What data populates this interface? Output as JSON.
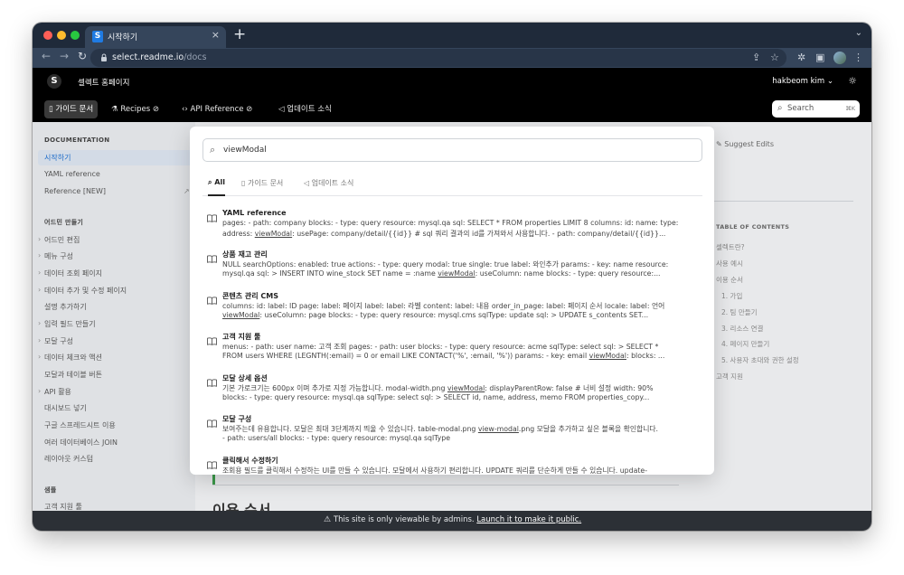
{
  "browser": {
    "tab_title": "시작하기",
    "tab_favicon": "S",
    "tab_close": "×",
    "new_tab": "+",
    "url_host": "select.readme.io",
    "url_path": "/docs"
  },
  "site": {
    "logo_letter": "S",
    "name": "셀렉트 홈페이지",
    "user": "hakbeom kim ⌄",
    "nav": [
      {
        "label": "가이드 문서"
      },
      {
        "label": "Recipes"
      },
      {
        "label": "API Reference"
      },
      {
        "label": "업데이트 소식"
      }
    ],
    "search_placeholder": "Search",
    "search_shortcut": "⌘K"
  },
  "sidebar": {
    "section1": "DOCUMENTATION",
    "items1": [
      "시작하기",
      "YAML reference",
      "Reference [NEW]"
    ],
    "section2": "어드민 만들기",
    "items2": [
      "어드민 편집",
      "메뉴 구성",
      "데이터 조회 페이지",
      "데이터 추가 및 수정 페이지",
      "설명 추가하기",
      "입력 필드 만들기",
      "모달 구성",
      "데이터 체크와 액션",
      "모달과 테이블 버튼",
      "API 활용",
      "대시보드 넣기",
      "구글 스프레드시트 이용",
      "여러 데이터베이스 JOIN",
      "레이아웃 커스텀"
    ],
    "section3": "샘플",
    "items3": [
      "고객 지원 툴"
    ]
  },
  "content": {
    "suggest_edits": "Suggest Edits",
    "heading_peek": "이용 순서",
    "toc_title": "TABLE OF CONTENTS",
    "toc": [
      "셀렉트란?",
      "사용 예시",
      "이용 순서",
      "1. 가입",
      "2. 팀 만들기",
      "3. 리소스 연결",
      "4. 페이지 만들기",
      "5. 사용자 초대와 권한 설정",
      "고객 지원"
    ]
  },
  "search_modal": {
    "query": "viewModal",
    "tabs": [
      "All",
      "가이드 문서",
      "업데이트 소식"
    ],
    "results": [
      {
        "title": "YAML reference",
        "line1": "pages: - path: company blocks: - type: query resource: mysql.qa sql: SELECT * FROM properties LIMIT 8 columns: id: name: type:",
        "l2_pre": "address: ",
        "l2_hit": "viewModal",
        "l2_post": ": usePage: company/detail/{{id}} # sql 쿼리 결과의 id를 가져와서 사용합니다. - path: company/detail/{{id}}..."
      },
      {
        "title": "상품 재고 관리",
        "line1": "NULL searchOptions: enabled: true actions: - type: query modal: true single: true label: 와인추가 params: - key: name resource:",
        "l2_pre": "mysql.qa sql: > INSERT INTO wine_stock SET name = :name ",
        "l2_hit": "viewModal",
        "l2_post": ": useColumn: name blocks: - type: query resource:..."
      },
      {
        "title": "콘텐츠 관리 CMS",
        "line1": "columns: id: label: ID page: label: 페이지 label: label: 라벨 content: label: 내용 order_in_page: label: 페이지 순서 locale: label: 언어",
        "l2_pre": "",
        "l2_hit": "viewModal",
        "l2_post": ": useColumn: page blocks: - type: query resource: mysql.cms sqlType: update sql: > UPDATE s_contents SET..."
      },
      {
        "title": "고객 지원 툴",
        "line1": "menus: - path: user name: 고객 조회 pages: - path: user blocks: - type: query resource: acme sqlType: select sql: > SELECT *",
        "l2_pre": "FROM users WHERE (LEGNTH(:email) = 0 or email LIKE CONTACT('%', :email, '%')) params: - key: email ",
        "l2_hit": "viewModal",
        "l2_post": ": blocks: ..."
      },
      {
        "title": "모달 상세 옵션",
        "line1_pre": "기본 가로크기는 600px 이며 추가로 지정 가능합니다. modal-width.png ",
        "line1_hit": "viewModal",
        "line1_post": ": displayParentRow: false # 너비 설정 width: 90%",
        "l2_pre": "blocks: - type: query resource: mysql.qa sqlType: select sql: > SELECT id, name, address, memo FROM properties_copy...",
        "l2_hit": "",
        "l2_post": ""
      },
      {
        "title": "모달 구성",
        "line1_pre": "보여주는데 유용합니다. 모달은 최대 3단계까지 띄울 수 있습니다. table-modal.png ",
        "line1_hit": "view-modal",
        "line1_post": ".png 모달을 추가하고 싶은 블록을 확인합니다.",
        "l2_pre": "- path: users/all blocks: - type: query resource: mysql.qa sqlType",
        "l2_hit": "",
        "l2_post": ""
      },
      {
        "title": "클릭해서 수정하기",
        "line1": "조회용 필드를 클릭해서 수정하는 UI를 만들 수 있습니다. 모달에서 사용하기 편리합니다. UPDATE 쿼리를 단순하게 만들 수 있습니다. update-"
      }
    ]
  },
  "admin_bar": {
    "message": "This site is only viewable by admins.",
    "link": "Launch it to make it public."
  },
  "icons": [
    "search-icon",
    "book-icon",
    "flask-icon",
    "code-icon",
    "megaphone-icon",
    "sun-icon",
    "lock-icon",
    "share-icon",
    "star-icon",
    "puzzle-icon",
    "sidebar-icon",
    "kebab-icon",
    "warning-icon"
  ]
}
